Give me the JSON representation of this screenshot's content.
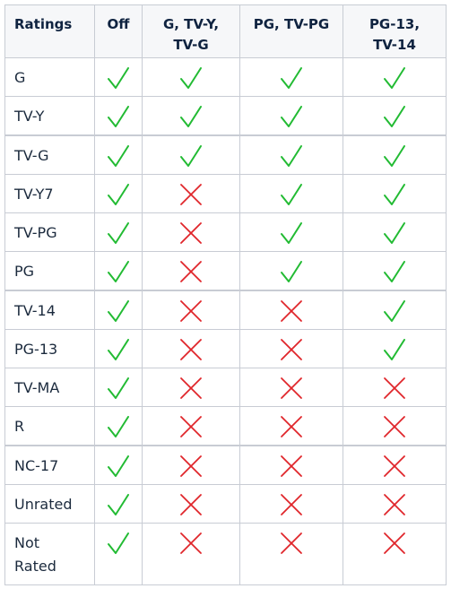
{
  "table": {
    "headers": [
      "Ratings",
      "Off",
      "G, TV-Y,\nTV-G",
      "PG, TV-PG",
      "PG-13,\nTV-14"
    ],
    "header_lines": [
      [
        "Ratings"
      ],
      [
        "Off"
      ],
      [
        "G, TV-Y,",
        "TV-G"
      ],
      [
        "PG, TV-PG"
      ],
      [
        "PG-13,",
        "TV-14"
      ]
    ],
    "rows": [
      {
        "rating": "G",
        "label_lines": [
          "G"
        ],
        "values": [
          "allowed",
          "allowed",
          "allowed",
          "allowed"
        ],
        "group_end": false
      },
      {
        "rating": "TV-Y",
        "label_lines": [
          "TV-Y"
        ],
        "values": [
          "allowed",
          "allowed",
          "allowed",
          "allowed"
        ],
        "group_end": true
      },
      {
        "rating": "TV-G",
        "label_lines": [
          "TV-G"
        ],
        "values": [
          "allowed",
          "allowed",
          "allowed",
          "allowed"
        ],
        "group_end": false
      },
      {
        "rating": "TV-Y7",
        "label_lines": [
          "TV-Y7"
        ],
        "values": [
          "allowed",
          "blocked",
          "allowed",
          "allowed"
        ],
        "group_end": false
      },
      {
        "rating": "TV-PG",
        "label_lines": [
          "TV-PG"
        ],
        "values": [
          "allowed",
          "blocked",
          "allowed",
          "allowed"
        ],
        "group_end": false
      },
      {
        "rating": "PG",
        "label_lines": [
          "PG"
        ],
        "values": [
          "allowed",
          "blocked",
          "allowed",
          "allowed"
        ],
        "group_end": true
      },
      {
        "rating": "TV-14",
        "label_lines": [
          "TV-14"
        ],
        "values": [
          "allowed",
          "blocked",
          "blocked",
          "allowed"
        ],
        "group_end": false
      },
      {
        "rating": "PG-13",
        "label_lines": [
          "PG-13"
        ],
        "values": [
          "allowed",
          "blocked",
          "blocked",
          "allowed"
        ],
        "group_end": false
      },
      {
        "rating": "TV-MA",
        "label_lines": [
          "TV-MA"
        ],
        "values": [
          "allowed",
          "blocked",
          "blocked",
          "blocked"
        ],
        "group_end": false
      },
      {
        "rating": "R",
        "label_lines": [
          "R"
        ],
        "values": [
          "allowed",
          "blocked",
          "blocked",
          "blocked"
        ],
        "group_end": true
      },
      {
        "rating": "NC-17",
        "label_lines": [
          "NC-17"
        ],
        "values": [
          "allowed",
          "blocked",
          "blocked",
          "blocked"
        ],
        "group_end": false
      },
      {
        "rating": "Unrated",
        "label_lines": [
          "Unrated"
        ],
        "values": [
          "allowed",
          "blocked",
          "blocked",
          "blocked"
        ],
        "group_end": false
      },
      {
        "rating": "Not Rated",
        "label_lines": [
          "Not",
          "Rated"
        ],
        "values": [
          "allowed",
          "blocked",
          "blocked",
          "blocked"
        ],
        "group_end": false
      }
    ]
  },
  "icons": {
    "allowed": {
      "name": "checkmark-icon",
      "color": "#22bb33"
    },
    "blocked": {
      "name": "cross-icon",
      "color": "#e0262b"
    }
  },
  "colors": {
    "header_bg": "#f6f7f9",
    "border": "#c8ccd4",
    "header_text": "#0f2340",
    "body_text": "#1b2a3d"
  }
}
